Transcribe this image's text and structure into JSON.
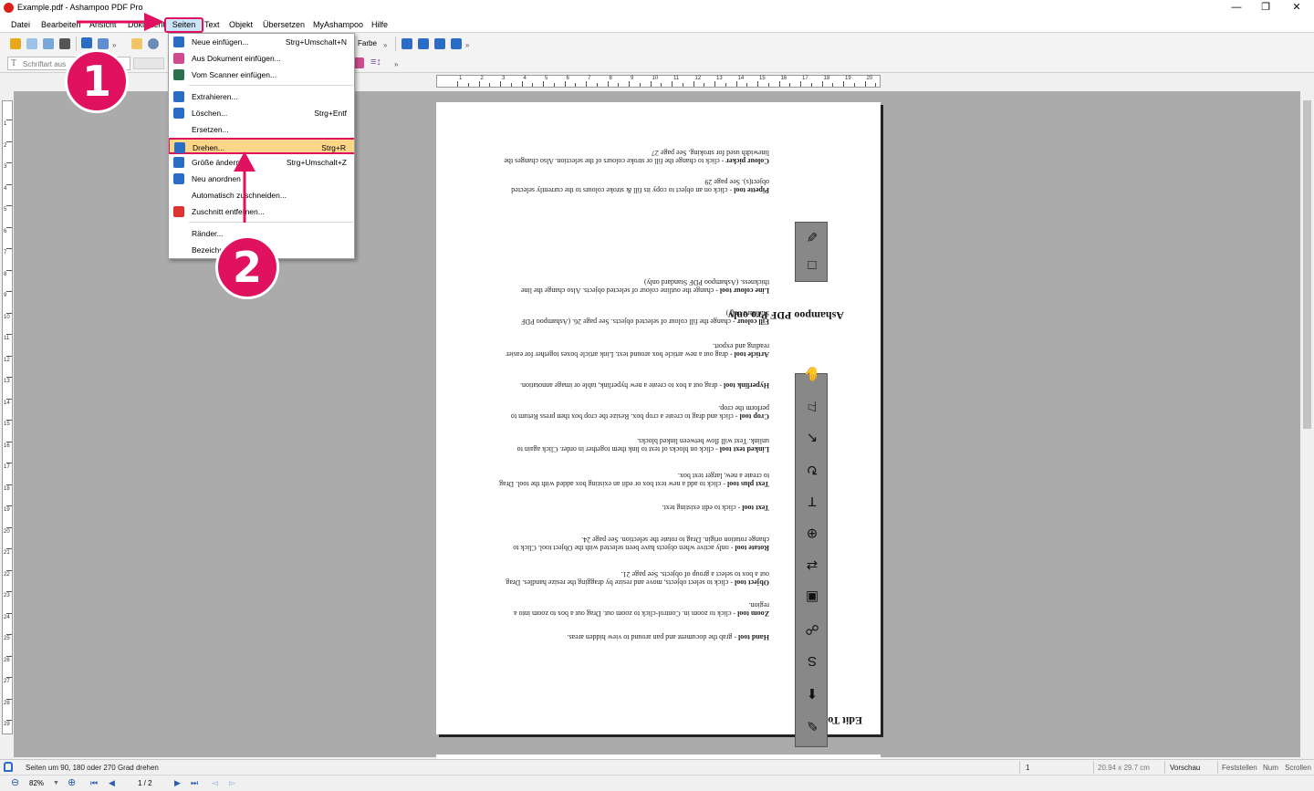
{
  "window": {
    "title": "Example.pdf - Ashampoo PDF Pro",
    "minimize": "—",
    "maximize": "❐",
    "close": "✕"
  },
  "menubar": {
    "items": [
      "Datei",
      "Bearbeiten",
      "Ansicht",
      "Dokument",
      "Seiten",
      "Text",
      "Objekt",
      "Übersetzen",
      "MyAshampoo",
      "Hilfe"
    ]
  },
  "toolbar": {
    "font_placeholder": "Schriftart aus",
    "color_label": "Farbe",
    "overflow": "»"
  },
  "seiten_menu": {
    "items": [
      {
        "label": "Neue einfügen...",
        "shortcut": "Strg+Umschalt+N",
        "icon": "insert-page-icon",
        "color": "#2b6cc4"
      },
      {
        "label": "Aus Dokument einfügen...",
        "shortcut": "",
        "icon": "insert-from-document-icon",
        "color": "#d04a8f"
      },
      {
        "label": "Vom Scanner einfügen...",
        "shortcut": "",
        "icon": "scanner-icon",
        "color": "#2e6f4e"
      },
      {
        "label": "Extrahieren...",
        "shortcut": "",
        "icon": "extract-icon",
        "color": "#2b6cc4"
      },
      {
        "label": "Löschen...",
        "shortcut": "Strg+Entf",
        "icon": "delete-page-icon",
        "color": "#2b6cc4"
      },
      {
        "label": "Ersetzen...",
        "shortcut": "",
        "icon": "",
        "color": ""
      },
      {
        "label": "Drehen...",
        "shortcut": "Strg+R",
        "icon": "rotate-page-icon",
        "color": "#2b6cc4"
      },
      {
        "label": "Größe ändern",
        "shortcut": "Strg+Umschalt+Z",
        "icon": "resize-icon",
        "color": "#2b6cc4"
      },
      {
        "label": "Neu anordnen",
        "shortcut": "",
        "icon": "sort-az-icon",
        "color": "#2b6cc4"
      },
      {
        "label": "Automatisch zuschneiden...",
        "shortcut": "",
        "icon": "",
        "color": ""
      },
      {
        "label": "Zuschnitt entfernen...",
        "shortcut": "",
        "icon": "remove-crop-icon",
        "color": "#d33"
      },
      {
        "label": "Ränder...",
        "shortcut": "",
        "icon": "",
        "color": ""
      },
      {
        "label": "Bezeichn",
        "shortcut": "",
        "icon": "",
        "color": ""
      }
    ]
  },
  "annotations": {
    "step1": "1",
    "step2": "2"
  },
  "ruler": {
    "h_numbers": [
      "1",
      "2",
      "3",
      "4",
      "5",
      "6",
      "7",
      "8",
      "9",
      "10",
      "11",
      "12",
      "13",
      "14",
      "15",
      "16",
      "17",
      "18",
      "19",
      "20"
    ],
    "v_numbers": [
      "1",
      "2",
      "3",
      "4",
      "5",
      "6",
      "7",
      "8",
      "9",
      "10",
      "11",
      "12",
      "13",
      "14",
      "15",
      "16",
      "17",
      "18",
      "19",
      "20",
      "21",
      "22",
      "23",
      "24",
      "25",
      "26",
      "27",
      "28",
      "29"
    ]
  },
  "document": {
    "section1_heading": "Edit Toolbar",
    "section2_heading": "Ashampoo PDF Pro only",
    "tool_entries": [
      {
        "name": "Hand tool",
        "desc": "- grab the document and pan around to view hidden areas."
      },
      {
        "name": "Zoom tool",
        "desc": "- click to zoom in. Control-click to zoom out. Drag out a box to zoom into a region."
      },
      {
        "name": "Object tool",
        "desc": "- click to select objects, move and resize by dragging the resize handles. Drag out a box to select a group of objects. See page 21."
      },
      {
        "name": "Rotate tool",
        "desc": "- only active when objects have been selected with the Object tool. Click to change rotation origin. Drag to rotate the selection. See page 24."
      },
      {
        "name": "Text tool",
        "desc": "- click to edit existing text."
      },
      {
        "name": "Text plus tool",
        "desc": "- click to add a new text box or edit an existing box added with the tool. Drag to create a new, larger text box."
      },
      {
        "name": "Linked text tool",
        "desc": "- click on blocks of text to link them together in order. Click again to unlink. Text will flow between linked blocks."
      },
      {
        "name": "Crop tool",
        "desc": "- click and drag to create a crop box. Resize the crop box then press Return to perform the crop."
      },
      {
        "name": "Hyperlink tool",
        "desc": "- drag out a box to create a new hyperlink, table or image annotation."
      },
      {
        "name": "Article tool",
        "desc": "- drag out a new article box around text. Link article boxes together for easier reading and export."
      },
      {
        "name": "Fill colour",
        "desc": "- change the fill colour of selected objects. See page 26. (Ashampoo PDF Standard only)"
      },
      {
        "name": "Line colour tool",
        "desc": "- change the outline colour of selected objects. Also change the line thickness. (Ashampoo PDF Standard only)"
      }
    ],
    "tool_entries_2": [
      {
        "name": "Pipette tool",
        "desc": "- click on an object to copy its fill & stroke colours to the currently selected object(s). See page 29"
      },
      {
        "name": "Colour picker",
        "desc": "- click to change the fill or stroke colours of the selection. Also changes the linewidth used for stroking. See page 27"
      }
    ],
    "strip_icons": [
      "✎",
      "⬆",
      "S",
      "☍",
      "▣",
      "⇄",
      "⊕",
      "T",
      "↻",
      "↖",
      "⚐",
      "✋"
    ],
    "strip2_icons": [
      "□",
      "✐"
    ]
  },
  "status": {
    "message": "Seiten um 90, 180 oder 270 Grad drehen",
    "page_index": "1",
    "page_size": "20.94 x 29.7 cm",
    "preview": "Vorschau",
    "caps": "Feststellen",
    "num": "Num",
    "scroll": "Scrollen"
  },
  "navigation": {
    "zoom": "82%",
    "page": "1 / 2"
  }
}
